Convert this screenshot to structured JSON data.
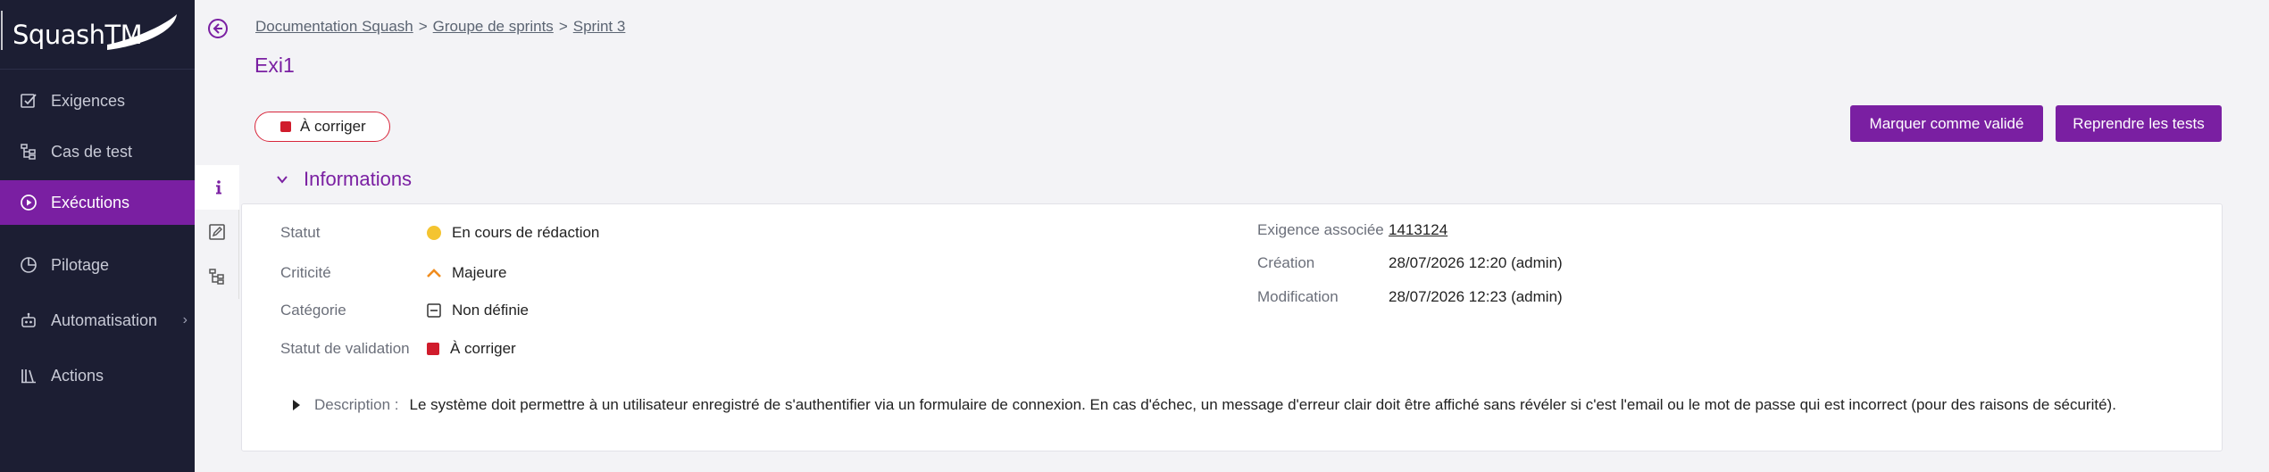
{
  "app": {
    "logo_text": "SquashTM"
  },
  "sidebar": {
    "items": [
      {
        "label": "Exigences",
        "icon": "checkbox-icon"
      },
      {
        "label": "Cas de test",
        "icon": "tree-icon"
      },
      {
        "label": "Exécutions",
        "icon": "play-circle-icon",
        "active": true
      },
      {
        "label": "Pilotage",
        "icon": "pie-chart-icon"
      },
      {
        "label": "Automatisation",
        "icon": "robot-icon",
        "has_submenu": true
      },
      {
        "label": "Actions",
        "icon": "library-icon"
      }
    ]
  },
  "breadcrumb": {
    "items": [
      "Documentation Squash",
      "Groupe de sprints",
      "Sprint 3"
    ],
    "separator": ">"
  },
  "page": {
    "title": "Exi1"
  },
  "status_pill": {
    "label": "À corriger",
    "color": "#d01c2c"
  },
  "actions": {
    "validate_label": "Marquer comme validé",
    "resume_label": "Reprendre les tests"
  },
  "section": {
    "title": "Informations"
  },
  "info": {
    "left": [
      {
        "label": "Statut",
        "value": "En cours de rédaction",
        "icon": "yellow-dot-icon"
      },
      {
        "label": "Criticité",
        "value": "Majeure",
        "icon": "caret-up-icon"
      },
      {
        "label": "Catégorie",
        "value": "Non définie",
        "icon": "minus-box-icon"
      },
      {
        "label": "Statut de validation",
        "value": "À corriger",
        "icon": "red-square-icon"
      }
    ],
    "right": [
      {
        "label": "Exigence associée",
        "value": "1413124"
      },
      {
        "label": "Création",
        "value": "28/07/2026 12:20 (admin)"
      },
      {
        "label": "Modification",
        "value": "28/07/2026 12:23 (admin)"
      }
    ]
  },
  "description": {
    "label": "Description :",
    "value": "Le système doit permettre à un utilisateur enregistré de s'authentifier via un formulaire de connexion. En cas d'échec, un message d'erreur clair doit être affiché sans révéler si c'est l'email ou le mot de passe qui est incorrect (pour des raisons de sécurité)."
  },
  "colors": {
    "brand": "#7a1fa2",
    "sidebar_bg": "#1c1e33",
    "status_yellow": "#f4c430",
    "status_red": "#d01c2c",
    "criticity_orange": "#f08c1e"
  }
}
